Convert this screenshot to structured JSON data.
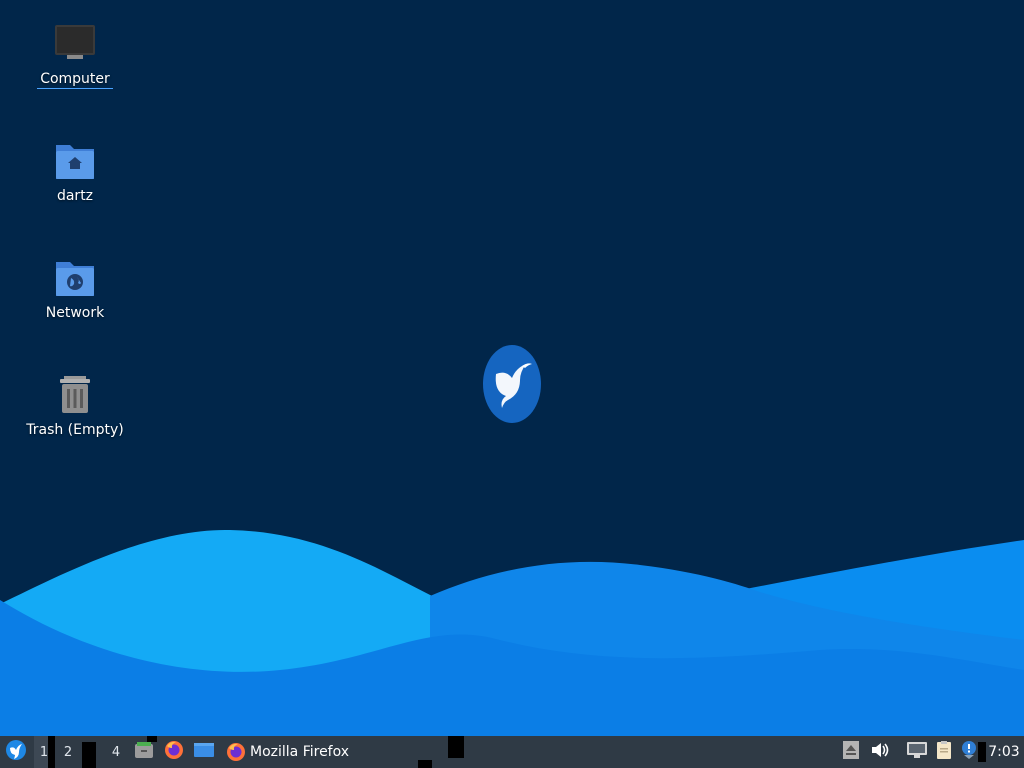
{
  "desktop": {
    "background_color": "#01264a",
    "wave_colors": [
      "#14aaf5",
      "#0a8df0",
      "#0f7fe8"
    ],
    "icons": [
      {
        "label": "Computer",
        "icon": "computer-icon",
        "selected": true
      },
      {
        "label": "dartz",
        "icon": "home-folder-icon"
      },
      {
        "label": "Network",
        "icon": "network-folder-icon"
      },
      {
        "label": "Trash (Empty)",
        "icon": "trash-icon"
      }
    ],
    "logo": "hummingbird-logo-icon"
  },
  "taskbar": {
    "background_color": "#2f3a45",
    "start_menu_icon": "start-menu-bird-icon",
    "workspaces": [
      "1",
      "2",
      "4"
    ],
    "active_workspace": "1",
    "launchers": [
      "file-manager-icon",
      "firefox-icon",
      "show-desktop-icon"
    ],
    "window_button": {
      "label": "Mozilla Firefox",
      "icon": "firefox-icon"
    },
    "tray_icons": [
      "eject-icon",
      "volume-icon",
      "network-icon",
      "clipboard-icon",
      "update-notifier-icon"
    ],
    "clock": "7:03"
  }
}
